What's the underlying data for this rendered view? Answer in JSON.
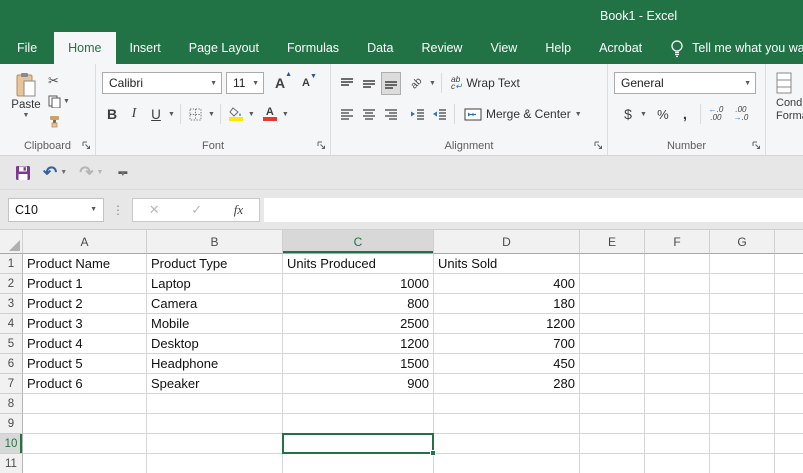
{
  "titlebar": {
    "title": "Book1 - Excel"
  },
  "tab_bar": {
    "tabs": [
      "File",
      "Home",
      "Insert",
      "Page Layout",
      "Formulas",
      "Data",
      "Review",
      "View",
      "Help",
      "Acrobat"
    ],
    "active_tab": "Home",
    "tell_me": "Tell me what you want to"
  },
  "ribbon": {
    "clipboard": {
      "group_label": "Clipboard",
      "paste_label": "Paste"
    },
    "font": {
      "group_label": "Font",
      "font_name": "Calibri",
      "font_size": "11",
      "bold": "B",
      "italic": "I",
      "underline": "U"
    },
    "alignment": {
      "group_label": "Alignment",
      "wrap_text_label": "Wrap Text",
      "merge_center_label": "Merge & Center"
    },
    "number": {
      "group_label": "Number",
      "number_format": "General",
      "currency": "$",
      "percent": "%",
      "comma": ","
    },
    "styles_partial": {
      "line1": "Cond",
      "line2": "Forma"
    }
  },
  "formula_bar": {
    "name_box": "C10",
    "fx_label": "fx",
    "formula_value": ""
  },
  "grid": {
    "columns": [
      "A",
      "B",
      "C",
      "D",
      "E",
      "F",
      "G"
    ],
    "selected_cell": {
      "column": "C",
      "row": 10
    },
    "rows": [
      {
        "num": 1,
        "cells": [
          "Product Name",
          "Product Type",
          "Units Produced",
          "Units Sold",
          "",
          "",
          ""
        ]
      },
      {
        "num": 2,
        "cells": [
          "Product 1",
          "Laptop",
          "1000",
          "400",
          "",
          "",
          ""
        ]
      },
      {
        "num": 3,
        "cells": [
          "Product 2",
          "Camera",
          "800",
          "180",
          "",
          "",
          ""
        ]
      },
      {
        "num": 4,
        "cells": [
          "Product 3",
          "Mobile",
          "2500",
          "1200",
          "",
          "",
          ""
        ]
      },
      {
        "num": 5,
        "cells": [
          "Product 4",
          "Desktop",
          "1200",
          "700",
          "",
          "",
          ""
        ]
      },
      {
        "num": 6,
        "cells": [
          "Product 5",
          "Headphone",
          "1500",
          "450",
          "",
          "",
          ""
        ]
      },
      {
        "num": 7,
        "cells": [
          "Product 6",
          "Speaker",
          "900",
          "280",
          "",
          "",
          ""
        ]
      },
      {
        "num": 8,
        "cells": [
          "",
          "",
          "",
          "",
          "",
          "",
          ""
        ]
      },
      {
        "num": 9,
        "cells": [
          "",
          "",
          "",
          "",
          "",
          "",
          ""
        ]
      },
      {
        "num": 10,
        "cells": [
          "",
          "",
          "",
          "",
          "",
          "",
          ""
        ]
      },
      {
        "num": 11,
        "cells": [
          "",
          "",
          "",
          "",
          "",
          "",
          ""
        ]
      }
    ]
  },
  "colors": {
    "excel_green": "#217346",
    "selection_border": "#217346",
    "font_color_bar": "#e8392b",
    "fill_color_bar": "#ffe800"
  }
}
